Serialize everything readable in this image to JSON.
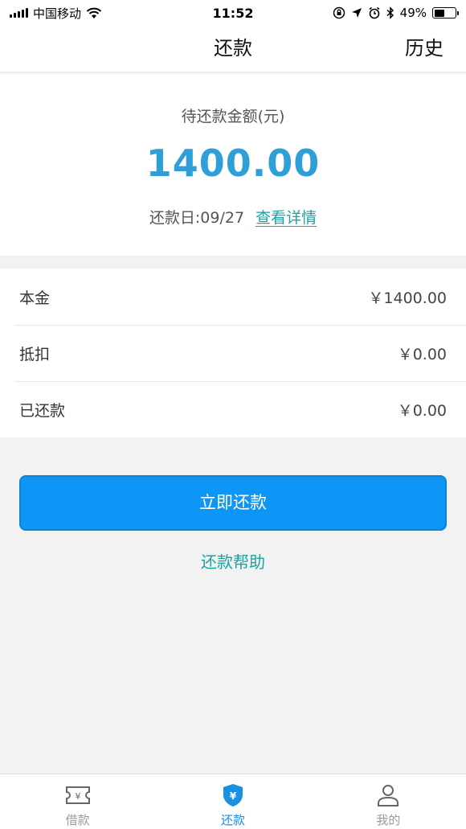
{
  "status_bar": {
    "carrier": "中国移动",
    "time": "11:52",
    "battery_percent": "49%",
    "battery_level": 0.49,
    "icons": [
      "signal-icon",
      "wifi-icon",
      "orientation-lock-icon",
      "location-icon",
      "alarm-icon",
      "bluetooth-icon",
      "battery-icon"
    ]
  },
  "nav": {
    "title": "还款",
    "history_label": "历史"
  },
  "amount": {
    "label": "待还款金额(元)",
    "value": "1400.00",
    "due_date_text": "还款日:09/27",
    "detail_link": "查看详情"
  },
  "breakdown": {
    "rows": [
      {
        "label": "本金",
        "value": "￥1400.00"
      },
      {
        "label": "抵扣",
        "value": "￥0.00"
      },
      {
        "label": "已还款",
        "value": "￥0.00"
      }
    ]
  },
  "actions": {
    "pay_button": "立即还款",
    "help_link": "还款帮助"
  },
  "tab_bar": {
    "active": "repay",
    "tabs": [
      {
        "id": "borrow",
        "label": "借款",
        "icon": "ticket-yen-icon"
      },
      {
        "id": "repay",
        "label": "还款",
        "icon": "shield-yen-icon"
      },
      {
        "id": "mine",
        "label": "我的",
        "icon": "user-icon"
      }
    ]
  },
  "colors": {
    "accent_blue": "#0d96f5",
    "amount_blue": "#2f9fd8",
    "link_teal": "#1aa3a3",
    "active_tab_blue": "#1b8fe0"
  }
}
